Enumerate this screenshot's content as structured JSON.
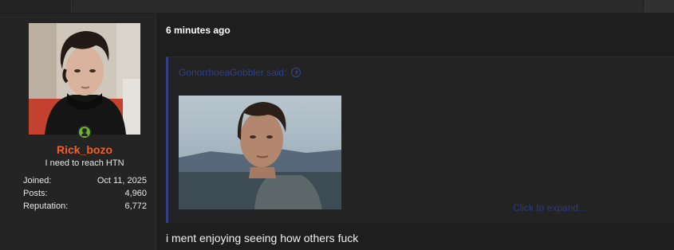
{
  "user": {
    "username": "Rick_bozo",
    "title": "I need to reach HTN",
    "stats": [
      {
        "label": "Joined:",
        "value": "Oct 11, 2025"
      },
      {
        "label": "Posts:",
        "value": "4,960"
      },
      {
        "label": "Reputation:",
        "value": "6,772"
      }
    ]
  },
  "post": {
    "time": "6 minutes ago",
    "quote": {
      "author_line": "GonorrhoeaGobbler said:",
      "expand_label": "Click to expand..."
    },
    "message": "i ment enjoying seeing how others fuck"
  },
  "colors": {
    "username": "#f0602a",
    "quote_border": "#2f3f86",
    "quote_link": "#2f3f8a",
    "online": "#6fb22b"
  },
  "icons": {
    "online": "user-online-icon",
    "quote_jump": "arrow-up-circle-icon"
  }
}
